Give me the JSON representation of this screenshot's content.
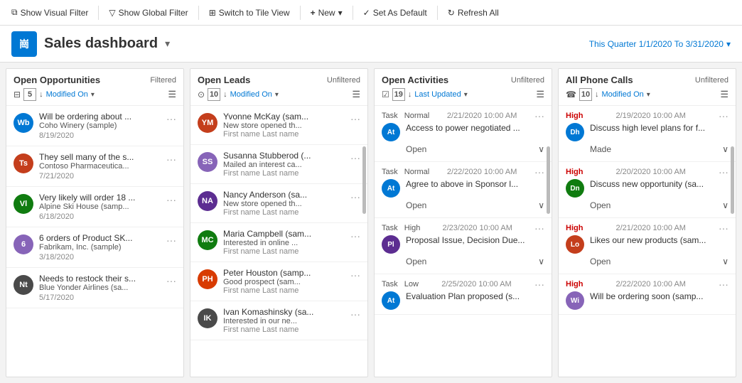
{
  "toolbar": {
    "show_visual_filter": "Show Visual Filter",
    "show_global_filter": "Show Global Filter",
    "switch_tile_view": "Switch to Tile View",
    "new": "New",
    "set_as_default": "Set As Default",
    "refresh_all": "Refresh All"
  },
  "header": {
    "title": "Sales dashboard",
    "quarter_label": "This Quarter 1/1/2020 To 3/31/2020",
    "logo_text": "崗"
  },
  "columns": [
    {
      "id": "open_opportunities",
      "title": "Open Opportunities",
      "filter_status": "Filtered",
      "count": 5,
      "sort_field": "Modified On",
      "items": [
        {
          "initials": "Wb",
          "color": "#0078d4",
          "title": "Will be ordering about ...",
          "subtitle": "Coho Winery (sample)",
          "date": "8/19/2020"
        },
        {
          "initials": "Ts",
          "color": "#c43e1c",
          "title": "They sell many of the s...",
          "subtitle": "Contoso Pharmaceutica...",
          "date": "7/21/2020"
        },
        {
          "initials": "Vl",
          "color": "#107c10",
          "title": "Very likely will order 18 ...",
          "subtitle": "Alpine Ski House (samp...",
          "date": "6/18/2020"
        },
        {
          "initials": "6",
          "color": "#8764b8",
          "title": "6 orders of Product SK...",
          "subtitle": "Fabrikam, Inc. (sample)",
          "date": "3/18/2020"
        },
        {
          "initials": "Nt",
          "color": "#4a4a4a",
          "title": "Needs to restock their s...",
          "subtitle": "Blue Yonder Airlines (sa...",
          "date": "5/17/2020"
        }
      ]
    },
    {
      "id": "open_leads",
      "title": "Open Leads",
      "filter_status": "Unfiltered",
      "count": 10,
      "sort_field": "Modified On",
      "items": [
        {
          "initials": "YM",
          "color": "#c43e1c",
          "title": "Yvonne McKay (sam...",
          "subtitle": "New store opened th...",
          "meta": "First name Last name"
        },
        {
          "initials": "SS",
          "color": "#8764b8",
          "title": "Susanna Stubberod (...",
          "subtitle": "Mailed an interest ca...",
          "meta": "First name Last name"
        },
        {
          "initials": "NA",
          "color": "#5c2d91",
          "title": "Nancy Anderson (sa...",
          "subtitle": "New store opened th...",
          "meta": "First name Last name"
        },
        {
          "initials": "MC",
          "color": "#107c10",
          "title": "Maria Campbell (sam...",
          "subtitle": "Interested in online ...",
          "meta": "First name Last name"
        },
        {
          "initials": "PH",
          "color": "#d83b01",
          "title": "Peter Houston (samp...",
          "subtitle": "Good prospect (sam...",
          "meta": "First name Last name"
        },
        {
          "initials": "IK",
          "color": "#4a4a4a",
          "title": "Ivan Komashinsky (sa...",
          "subtitle": "Interested in our ne...",
          "meta": "First name Last name"
        }
      ]
    },
    {
      "id": "open_activities",
      "title": "Open Activities",
      "filter_status": "Unfiltered",
      "count": 19,
      "sort_field": "Last Updated",
      "activities": [
        {
          "type": "Task  Normal",
          "date": "2/21/2020 10:00 AM",
          "avatar_initials": "At",
          "avatar_color": "#0078d4",
          "text": "Access to power negotiated ...",
          "status": "Open"
        },
        {
          "type": "Task  Normal",
          "date": "2/22/2020 10:00 AM",
          "avatar_initials": "At",
          "avatar_color": "#0078d4",
          "text": "Agree to above in Sponsor l...",
          "status": "Open"
        },
        {
          "type": "Task  High",
          "date": "2/23/2020 10:00 AM",
          "avatar_initials": "Pl",
          "avatar_color": "#5c2d91",
          "text": "Proposal Issue, Decision Due...",
          "status": "Open"
        },
        {
          "type": "Task  Low",
          "date": "2/25/2020 10:00 AM",
          "avatar_initials": "At",
          "avatar_color": "#0078d4",
          "text": "Evaluation Plan proposed (s...",
          "status": "Open"
        }
      ]
    },
    {
      "id": "all_phone_calls",
      "title": "All Phone Calls",
      "filter_status": "Unfiltered",
      "count": 10,
      "sort_field": "Modified On",
      "calls": [
        {
          "priority": "High",
          "date": "2/19/2020 10:00 AM",
          "avatar_initials": "Dh",
          "avatar_color": "#0078d4",
          "text": "Discuss high level plans for f...",
          "status": "Made"
        },
        {
          "priority": "High",
          "date": "2/20/2020 10:00 AM",
          "avatar_initials": "Dn",
          "avatar_color": "#107c10",
          "text": "Discuss new opportunity (sa...",
          "status": "Open"
        },
        {
          "priority": "High",
          "date": "2/21/2020 10:00 AM",
          "avatar_initials": "Lo",
          "avatar_color": "#c43e1c",
          "text": "Likes our new products (sam...",
          "status": "Open"
        },
        {
          "priority": "High",
          "date": "2/22/2020 10:00 AM",
          "avatar_initials": "Wi",
          "avatar_color": "#8764b8",
          "text": "Will be ordering soon (samp...",
          "status": "Open"
        }
      ]
    }
  ]
}
